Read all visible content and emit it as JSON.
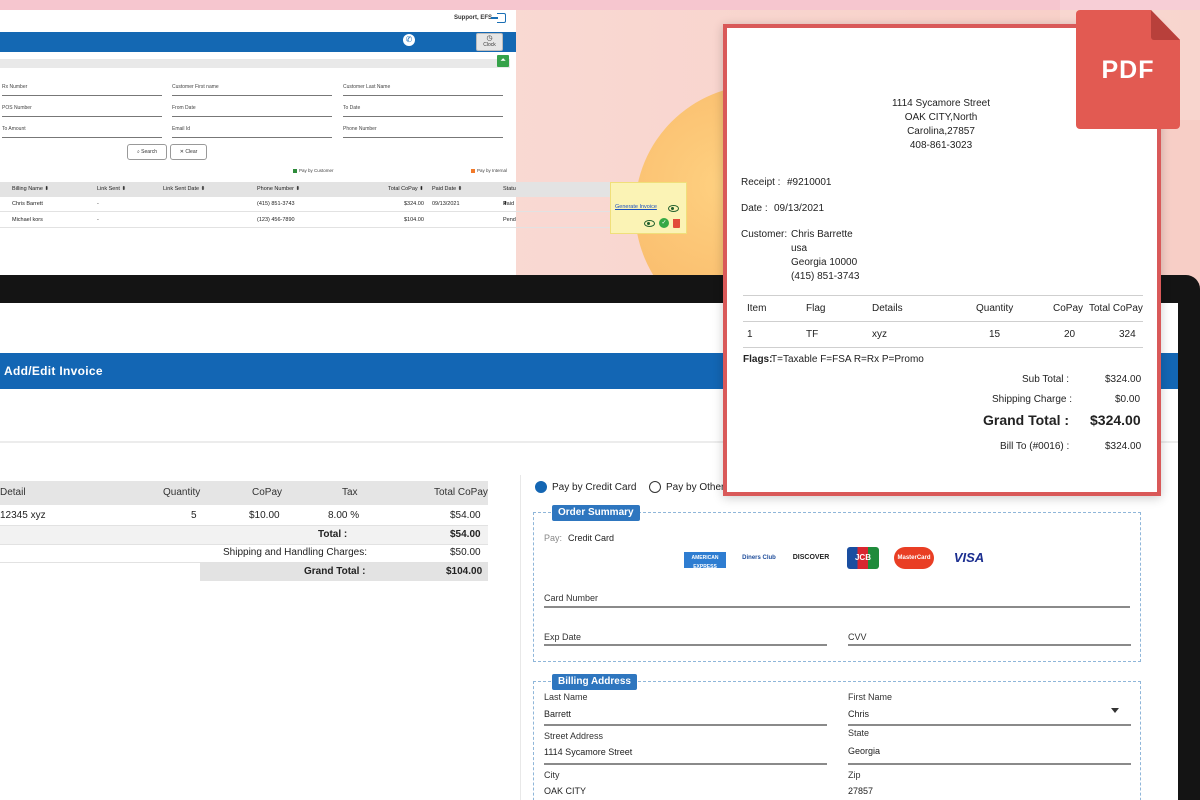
{
  "top_list": {
    "user": "Support, EFS",
    "clock_label": "Clock",
    "filters": [
      "Rx Number",
      "Customer First name",
      "Customer Last Name",
      "POS Number",
      "From Date",
      "To Date",
      "To Amount",
      "Email Id",
      "Phone Number"
    ],
    "search_label": "Search",
    "clear_label": "Clear",
    "legend_customer": "Pay by Customer",
    "legend_internal": "Pay by Internal",
    "columns": [
      "Billing Name ⬍",
      "Link Sent ⬍",
      "Link Sent Date ⬍",
      "Phone Number ⬍",
      "Total CoPay ⬍",
      "Paid Date ⬍",
      "Status ⬍"
    ],
    "rows": [
      {
        "name": "Chris Barrett",
        "link": "-",
        "phone": "(415) 851-3743",
        "copay": "$324.00",
        "paid_date": "09/13/2021",
        "status": "Paid"
      },
      {
        "name": "Michael kors",
        "link": "-",
        "phone": "(123) 456-7890",
        "copay": "$104.00",
        "paid_date": "",
        "status": "Pending"
      }
    ],
    "generate_invoice": "Generate Invoice"
  },
  "form": {
    "title": "Add/Edit Invoice",
    "table_headers": [
      "Detail",
      "Quantity",
      "CoPay",
      "Tax",
      "Total CoPay"
    ],
    "row": {
      "detail": "12345 xyz",
      "quantity": "5",
      "copay": "$10.00",
      "tax": "8.00 %",
      "total": "$54.00"
    },
    "total_label": "Total :",
    "total_value": "$54.00",
    "shipping_label": "Shipping and Handling Charges:",
    "shipping_value": "$50.00",
    "grand_label": "Grand Total :",
    "grand_value": "$104.00"
  },
  "payment": {
    "option_card": "Pay by Credit Card",
    "option_other": "Pay by Other",
    "order_summary": "Order Summary",
    "pay_label": "Pay:",
    "pay_value": "Credit Card",
    "card_logos": [
      "AMERICAN EXPRESS",
      "Diners Club",
      "DISCOVER",
      "JCB",
      "MasterCard",
      "VISA"
    ],
    "card_number_label": "Card Number",
    "exp_label": "Exp Date",
    "cvv_label": "CVV",
    "billing_address": "Billing Address",
    "last_name_label": "Last Name",
    "last_name": "Barrett",
    "first_name_label": "First Name",
    "first_name": "Chris",
    "street_label": "Street Address",
    "street": "1114 Sycamore Street",
    "state_label": "State",
    "state": "Georgia",
    "city_label": "City",
    "city": "OAK CITY",
    "zip_label": "Zip",
    "zip": "27857"
  },
  "receipt": {
    "badge": "PDF",
    "address1": "1114 Sycamore Street",
    "address2": "OAK CITY,North",
    "address3": "Carolina,27857",
    "phone": "408-861-3023",
    "receipt_label": "Receipt :",
    "receipt_no": "#9210001",
    "date_label": "Date :",
    "date": "09/13/2021",
    "customer_label": "Customer:",
    "customer_name": "Chris Barrette",
    "customer_country": "usa",
    "customer_region": "Georgia 10000",
    "customer_phone": "(415) 851-3743",
    "columns": [
      "Item",
      "Flag",
      "Details",
      "Quantity",
      "CoPay",
      "Total CoPay"
    ],
    "item": {
      "no": "1",
      "flag": "TF",
      "details": "xyz",
      "quantity": "15",
      "copay": "20",
      "total": "324"
    },
    "flags_label": "Flags:",
    "flags_text": "T=Taxable F=FSA R=Rx P=Promo",
    "subtotal_label": "Sub Total :",
    "subtotal": "$324.00",
    "shipping_label": "Shipping Charge :",
    "shipping": "$0.00",
    "grand_label": "Grand Total :",
    "grand": "$324.00",
    "billto_label": "Bill To (#0016) :",
    "billto": "$324.00"
  },
  "colors": {
    "primary": "#1366b4",
    "pdf_red": "#e25a52",
    "section_tag": "#2e76bf"
  }
}
